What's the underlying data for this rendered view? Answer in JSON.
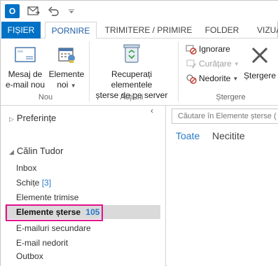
{
  "quick_access": {
    "logo_letter": "O",
    "icons": [
      "outlook-icon",
      "send-receive-icon",
      "undo-icon",
      "customize-icon"
    ]
  },
  "tabs": {
    "file": "FIȘIER",
    "home": "PORNIRE",
    "send_receive": "TRIMITERE / PRIMIRE",
    "folder": "FOLDER",
    "view": "VIZUA"
  },
  "ribbon": {
    "new_group": {
      "label": "Nou",
      "new_email_line1": "Mesaj de",
      "new_email_line2": "e-mail nou",
      "new_items_line1": "Elemente",
      "new_items_line2": "noi"
    },
    "actions_group": {
      "label": "Acțiuni",
      "recover_line1": "Recuperați elementele",
      "recover_line2": "șterse de pe server"
    },
    "delete_group": {
      "label": "Ștergere",
      "ignore": "Ignorare",
      "cleanup": "Curățare",
      "junk": "Nedorite",
      "delete": "Ștergere"
    }
  },
  "nav": {
    "favorites": "Preferințe",
    "account": "Călin Tudor",
    "folders": [
      {
        "name": "Inbox",
        "count": ""
      },
      {
        "name": "Schițe",
        "count": "[3]"
      },
      {
        "name": "Elemente trimise",
        "count": ""
      },
      {
        "name": "Elemente șterse",
        "count": "105"
      },
      {
        "name": "E-mailuri secundare",
        "count": ""
      },
      {
        "name": "E-mail nedorit",
        "count": ""
      },
      {
        "name": "Outbox",
        "count": ""
      }
    ]
  },
  "main": {
    "search_placeholder": "Căutare în Elemente șterse (",
    "filter_all": "Toate",
    "filter_unread": "Necitite"
  },
  "colors": {
    "accent": "#0072c6",
    "link_blue": "#2a7ac9",
    "highlight": "#e0138c",
    "selection": "#dadada"
  }
}
